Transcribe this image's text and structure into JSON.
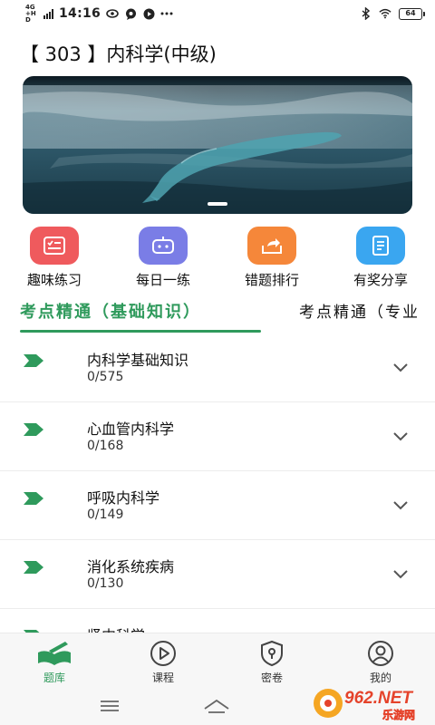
{
  "status_bar": {
    "net": "4G+HD",
    "time": "14:16",
    "battery": "64"
  },
  "header": {
    "title": "【 303 】内科学(中级)"
  },
  "quick_nav": [
    {
      "label": "趣味练习",
      "icon": "quiz-icon",
      "color": "#ef5a5d"
    },
    {
      "label": "每日一练",
      "icon": "robot-icon",
      "color": "#7a7de6"
    },
    {
      "label": "错题排行",
      "icon": "share-tray-icon",
      "color": "#f5873a"
    },
    {
      "label": "有奖分享",
      "icon": "notebook-icon",
      "color": "#3aa6f0"
    }
  ],
  "tabs": {
    "active": "考点精通（基础知识）",
    "next": "考点精通（专业"
  },
  "chapters": [
    {
      "title": "内科学基础知识",
      "progress": "0/575"
    },
    {
      "title": "心血管内科学",
      "progress": "0/168"
    },
    {
      "title": "呼吸内科学",
      "progress": "0/149"
    },
    {
      "title": "消化系统疾病",
      "progress": "0/130"
    },
    {
      "title": "肾内科学",
      "progress": ""
    }
  ],
  "bottom_nav": [
    {
      "label": "题库",
      "icon": "book-pen-icon",
      "active": true
    },
    {
      "label": "课程",
      "icon": "play-circle-icon",
      "active": false
    },
    {
      "label": "密卷",
      "icon": "lock-shield-icon",
      "active": false
    },
    {
      "label": "我的",
      "icon": "user-icon",
      "active": false
    }
  ],
  "watermark": {
    "brand": "962.NET",
    "sub": "乐游网"
  },
  "colors": {
    "accent": "#2f9a5c"
  }
}
